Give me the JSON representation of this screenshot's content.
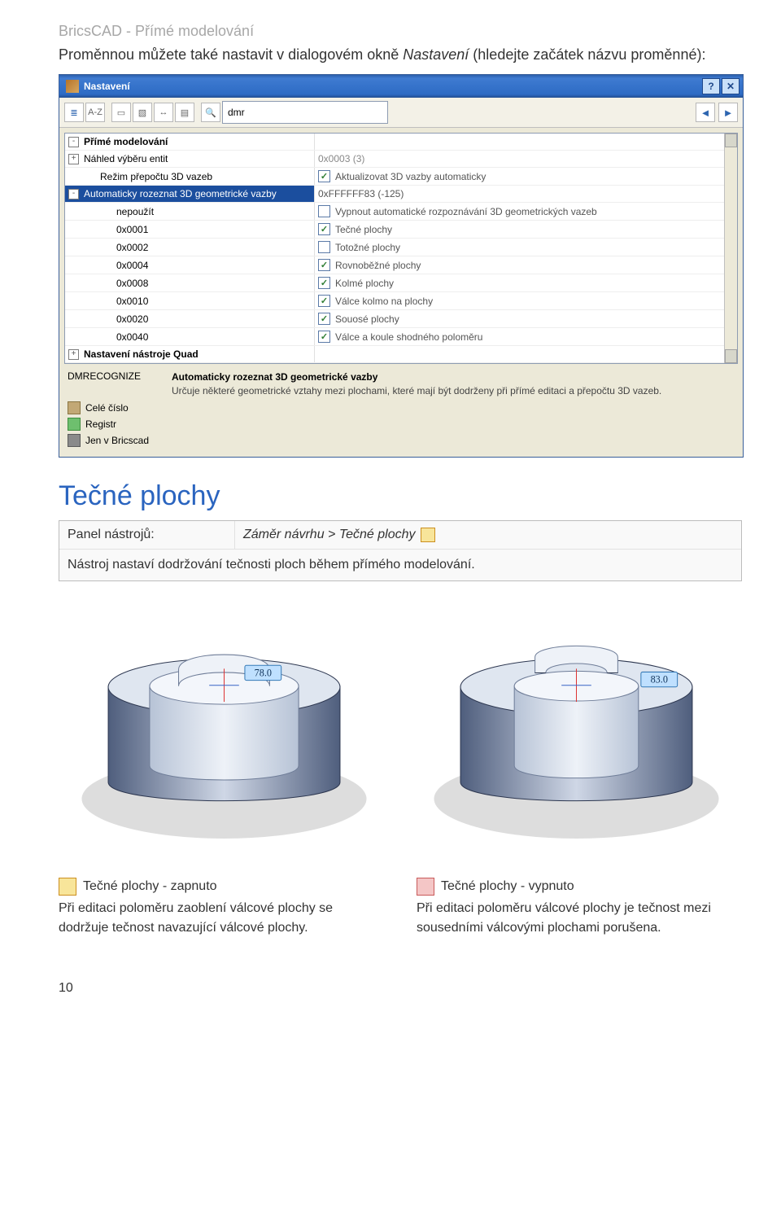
{
  "header": "BricsCAD - Přímé modelování",
  "intro": {
    "pre": "Proměnnou můžete také nastavit v dialogovém okně ",
    "ital": "Nastavení",
    "post": " (hledejte začátek názvu proměnné):"
  },
  "dialog": {
    "title": "Nastavení",
    "toolbar": {
      "icons": [
        "tree",
        "az",
        "add",
        "cat",
        "arrow",
        "grid",
        "find"
      ],
      "search_value": "dmr",
      "prev": "◄",
      "next": "►"
    },
    "buttons": {
      "help": "?",
      "close": "✕"
    },
    "rows": [
      {
        "expand": "-",
        "indent": 0,
        "label": "Přímé modelování",
        "bold": true,
        "value": ""
      },
      {
        "expand": "+",
        "indent": 0,
        "label": "Náhled výběru entit",
        "value": "0x0003 (3)",
        "valgray": true
      },
      {
        "expand": "",
        "indent": 1,
        "label": "Režim přepočtu 3D vazeb",
        "value": "Aktualizovat 3D vazby automaticky",
        "cb": "✓"
      },
      {
        "expand": "-",
        "indent": 0,
        "label": "Automaticky rozeznat 3D geometrické vazby",
        "value": "0xFFFFFF83 (-125)",
        "sel": true
      },
      {
        "expand": "",
        "indent": 2,
        "label": "nepoužít",
        "value": "Vypnout automatické rozpoznávání 3D geometrických vazeb",
        "cb": ""
      },
      {
        "expand": "",
        "indent": 2,
        "label": "0x0001",
        "value": "Tečné plochy",
        "cb": "✓"
      },
      {
        "expand": "",
        "indent": 2,
        "label": "0x0002",
        "value": "Totožné plochy",
        "cb": ""
      },
      {
        "expand": "",
        "indent": 2,
        "label": "0x0004",
        "value": "Rovnoběžné plochy",
        "cb": "✓"
      },
      {
        "expand": "",
        "indent": 2,
        "label": "0x0008",
        "value": "Kolmé plochy",
        "cb": "✓"
      },
      {
        "expand": "",
        "indent": 2,
        "label": "0x0010",
        "value": "Válce kolmo na plochy",
        "cb": "✓"
      },
      {
        "expand": "",
        "indent": 2,
        "label": "0x0020",
        "value": "Souosé plochy",
        "cb": "✓"
      },
      {
        "expand": "",
        "indent": 2,
        "label": "0x0040",
        "value": "Válce a koule shodného poloměru",
        "cb": "✓"
      },
      {
        "expand": "+",
        "indent": 0,
        "label": "Nastavení nástroje Quad",
        "bold": true,
        "value": ""
      }
    ],
    "info": {
      "var": "DMRECOGNIZE",
      "title": "Automaticky rozeznat 3D geometrické vazby",
      "desc": "Určuje některé geometrické vztahy mezi plochami, které mají být dodrženy při přímé editaci a přepočtu 3D vazeb.",
      "l1": "Celé číslo",
      "l2": "Registr",
      "l3": "Jen v Bricscad"
    }
  },
  "section": {
    "heading": "Tečné plochy",
    "panel_label": "Panel nástrojů:",
    "panel_value": "Záměr návrhu > Tečné plochy",
    "desc": "Nástroj nastaví dodržování tečnosti ploch během přímého modelování."
  },
  "fig_labels": {
    "left": "78.0",
    "right": "83.0"
  },
  "captions": {
    "left_title": "Tečné plochy - zapnuto",
    "left_body": "Při editaci poloměru zaoblení válcové plochy se dodržuje tečnost navazující válcové plochy.",
    "right_title": "Tečné plochy - vypnuto",
    "right_body": "Při editaci poloměru válcové plochy je tečnost mezi sousedními válcovými plochami porušena."
  },
  "page_number": "10"
}
